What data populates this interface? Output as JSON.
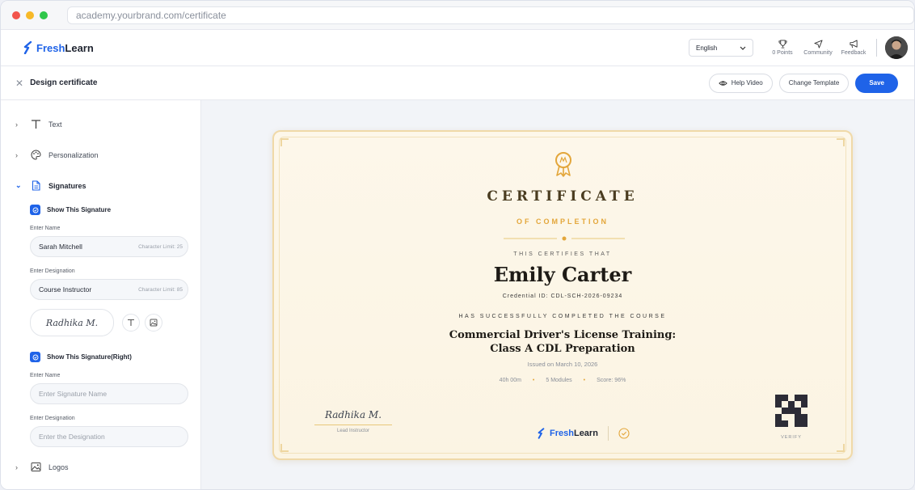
{
  "browser": {
    "url": "academy.yourbrand.com/certificate"
  },
  "colors": {
    "accent": "#1f63e8",
    "gold": "#e3a63a"
  },
  "header": {
    "logo_prefix": "Fresh",
    "logo_suffix": "Learn",
    "language": "English",
    "nav": [
      {
        "label": "0 Points",
        "icon": "trophy-icon"
      },
      {
        "label": "Community",
        "icon": "send-icon"
      },
      {
        "label": "Feedback",
        "icon": "megaphone-icon"
      }
    ]
  },
  "toolbar": {
    "title": "Design certificate",
    "help_label": "Help Video",
    "change_label": "Change Template",
    "save_label": "Save"
  },
  "sidebar": {
    "sections": [
      {
        "label": "Text",
        "icon": "text-icon"
      },
      {
        "label": "Personalization",
        "icon": "palette-icon"
      },
      {
        "label": "Signatures",
        "icon": "document-icon"
      },
      {
        "label": "Logos",
        "icon": "image-icon"
      }
    ],
    "sig_left": {
      "checkbox_label": "Show This Signature",
      "name_label": "Enter Name",
      "name_value": "Sarah Mitchell",
      "name_limit": "Character Limit: 25",
      "designation_label": "Enter Designation",
      "designation_value": "Course Instructor",
      "designation_limit": "Character Limit: 85",
      "signature_preview": "Radhika M."
    },
    "sig_right": {
      "checkbox_label": "Show This Signature(Right)",
      "name_label": "Enter Name",
      "name_placeholder": "Enter Signature Name",
      "designation_label": "Enter Designation",
      "designation_placeholder": "Enter the Designation"
    }
  },
  "certificate": {
    "title": "CERTIFICATE",
    "subtitle": "OF COMPLETION",
    "certifies": "THIS CERTIFIES THAT",
    "recipient": "Emily Carter",
    "credential": "Credential ID: CDL-SCH-2026-09234",
    "completed": "HAS SUCCESSFULLY COMPLETED THE COURSE",
    "course_line1": "Commercial Driver's License Training:",
    "course_line2": "Class A CDL Preparation",
    "issued": "Issued on March 10, 2026",
    "duration": "40h 00m",
    "modules": "5 Modules",
    "score": "Score: 96%",
    "signature": "Radhika M.",
    "signature_role": "Lead Instructor",
    "brand_prefix": "Fresh",
    "brand_suffix": "Learn",
    "verify": "VERIFY"
  }
}
